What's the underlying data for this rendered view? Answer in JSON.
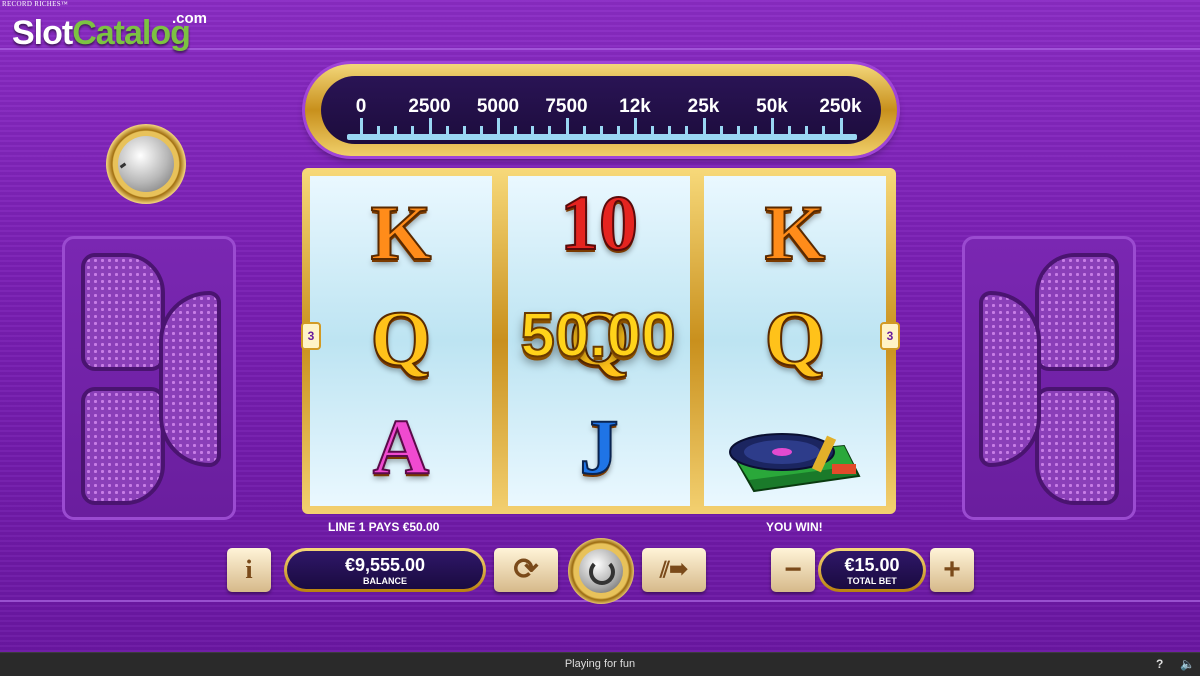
{
  "game_title": "RECORD RICHES™",
  "watermark": {
    "part1": "Slot",
    "part2": "Catalog",
    "suffix": ".com"
  },
  "meter": {
    "labels": [
      "0",
      "2500",
      "5000",
      "7500",
      "12k",
      "25k",
      "50k",
      "250k"
    ]
  },
  "reels": [
    [
      "K",
      "Q",
      "A"
    ],
    [
      "10",
      "Q",
      "J"
    ],
    [
      "K",
      "Q",
      "turntable"
    ]
  ],
  "line_badge_left": "3",
  "line_badge_right": "3",
  "win_amount": "50.00",
  "messages": {
    "line_pays": "LINE 1 PAYS €50.00",
    "you_win": "YOU WIN!"
  },
  "controls": {
    "info_label": "i",
    "balance_value": "€9,555.00",
    "balance_label": "BALANCE",
    "total_bet_value": "€15.00",
    "total_bet_label": "TOTAL BET",
    "minus_label": "−",
    "plus_label": "+"
  },
  "footer": {
    "status": "Playing for fun",
    "help_label": "?"
  },
  "colors": {
    "background": "#7a1fb4",
    "gold": "#d29a24",
    "panel_dark": "#1c0c3c"
  }
}
